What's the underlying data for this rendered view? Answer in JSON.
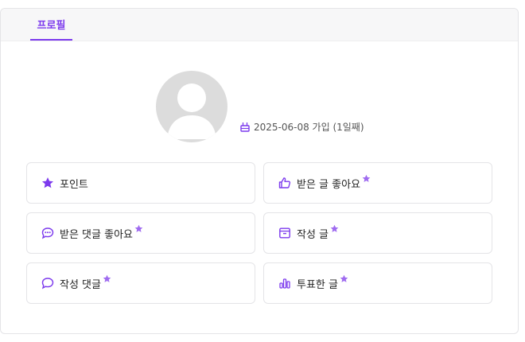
{
  "tabs": [
    {
      "label": "프로필",
      "active": true
    }
  ],
  "profile": {
    "join_text": "2025-06-08 가입 (1일째)",
    "avatar_icon": "default-user-avatar"
  },
  "accent_color": "#7c3aed",
  "stats": [
    {
      "label": "포인트",
      "icon": "star-icon",
      "starred": false
    },
    {
      "label": "받은 글 좋아요",
      "icon": "thumbs-up-icon",
      "starred": true
    },
    {
      "label": "받은 댓글 좋아요",
      "icon": "chat-dots-icon",
      "starred": true
    },
    {
      "label": "작성 글",
      "icon": "document-icon",
      "starred": true
    },
    {
      "label": "작성 댓글",
      "icon": "chat-bubble-icon",
      "starred": true
    },
    {
      "label": "투표한 글",
      "icon": "bar-chart-icon",
      "starred": true
    }
  ]
}
